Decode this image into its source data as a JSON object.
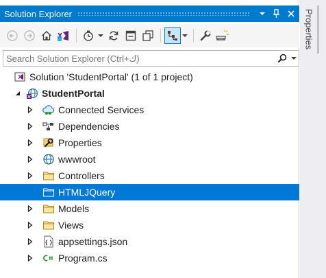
{
  "window": {
    "title": "Solution Explorer"
  },
  "titlebar": {
    "icons": [
      "chevron-down-icon",
      "pin-icon",
      "close-icon"
    ]
  },
  "toolbar": {
    "icons": [
      "back-icon",
      "forward-icon",
      "home-icon",
      "vs-switch-views-icon",
      "pending-changes-icon",
      "history-clock-icon",
      "sync-icon",
      "collapse-all-icon",
      "show-all-files-icon",
      "view-class-diagram-icon",
      "properties-wrench-icon",
      "preview-selected-icon"
    ]
  },
  "search": {
    "placeholder": "Search Solution Explorer (Ctrl+ك)"
  },
  "tree": {
    "solution": {
      "label": "Solution 'StudentPortal' (1 of 1 project)"
    },
    "project": {
      "label": "StudentPortal"
    },
    "items": [
      {
        "label": "Connected Services",
        "icon": "connected-services-icon",
        "expandable": true
      },
      {
        "label": "Dependencies",
        "icon": "dependencies-icon",
        "expandable": true
      },
      {
        "label": "Properties",
        "icon": "properties-icon",
        "expandable": true
      },
      {
        "label": "wwwroot",
        "icon": "globe-icon",
        "expandable": true
      },
      {
        "label": "Controllers",
        "icon": "folder-icon",
        "expandable": true
      },
      {
        "label": "HTMLJQuery",
        "icon": "folder-icon",
        "expandable": false,
        "selected": true
      },
      {
        "label": "Models",
        "icon": "folder-icon",
        "expandable": true
      },
      {
        "label": "Views",
        "icon": "folder-icon",
        "expandable": true
      },
      {
        "label": "appsettings.json",
        "icon": "json-file-icon",
        "expandable": true
      },
      {
        "label": "Program.cs",
        "icon": "csharp-file-icon",
        "expandable": true
      }
    ]
  },
  "sidetab": {
    "label": "Properties"
  },
  "colors": {
    "accent": "#007acc",
    "selection": "#0078d7"
  }
}
